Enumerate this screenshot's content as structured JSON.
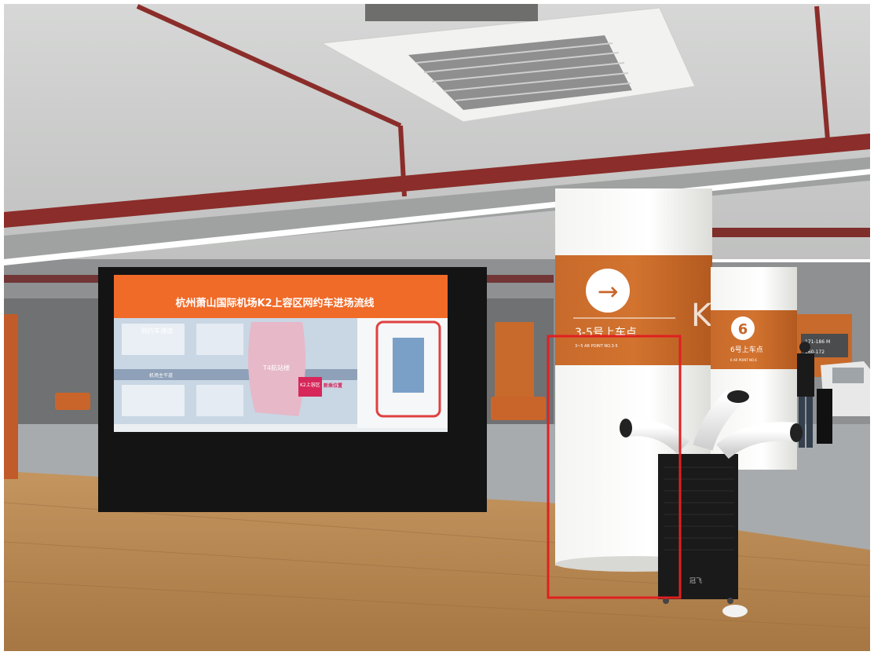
{
  "screen": {
    "title": "杭州萧山国际机场K2上容区网约车进场流线",
    "labels": {
      "route": "网约车通道",
      "terminal": "T4航站楼",
      "area": "K2上容区",
      "station": "新乘位置",
      "road": "机场主干道"
    }
  },
  "pillar_left": {
    "arrow": "→",
    "main_text": "3-5号上车点",
    "sub_text": "3~5 AR POINT NO.3-5",
    "letter": "K"
  },
  "pillar_right": {
    "number": "6",
    "main_text": "6号上车点",
    "sub_text": "6 AR POINT NO.6"
  },
  "far_sign": {
    "line1": "171-186 M",
    "line2": "160-172"
  },
  "device": {
    "brand": "冠飞"
  },
  "highlight": {
    "color": "#e02020"
  }
}
